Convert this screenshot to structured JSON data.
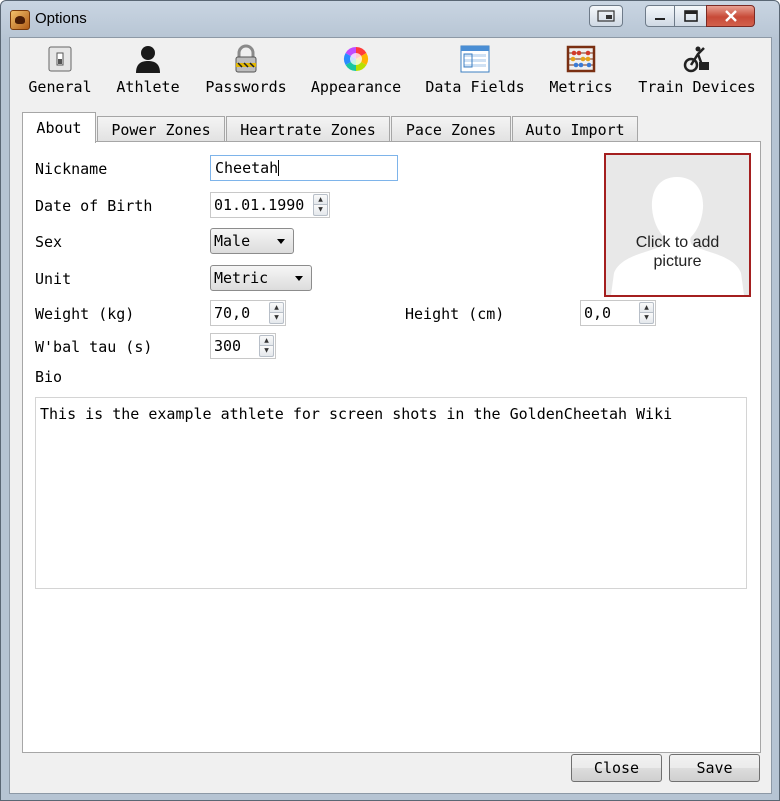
{
  "window": {
    "title": "Options"
  },
  "toolbar": {
    "items": [
      {
        "label": "General",
        "icon": "general-icon"
      },
      {
        "label": "Athlete",
        "icon": "athlete-icon"
      },
      {
        "label": "Passwords",
        "icon": "lock-icon"
      },
      {
        "label": "Appearance",
        "icon": "color-wheel-icon"
      },
      {
        "label": "Data Fields",
        "icon": "data-fields-icon"
      },
      {
        "label": "Metrics",
        "icon": "abacus-icon"
      },
      {
        "label": "Train Devices",
        "icon": "trainer-icon"
      }
    ]
  },
  "tabs": [
    {
      "label": "About",
      "active": true
    },
    {
      "label": "Power Zones"
    },
    {
      "label": "Heartrate Zones"
    },
    {
      "label": "Pace Zones"
    },
    {
      "label": "Auto Import"
    }
  ],
  "about": {
    "nickname_label": "Nickname",
    "nickname_value": "Cheetah",
    "dob_label": "Date of Birth",
    "dob_value": "01.01.1990",
    "sex_label": "Sex",
    "sex_value": "Male",
    "unit_label": "Unit",
    "unit_value": "Metric",
    "weight_label": "Weight (kg)",
    "weight_value": "70,0",
    "height_label": "Height (cm)",
    "height_value": "0,0",
    "wbal_label": "W'bal tau (s)",
    "wbal_value": "300",
    "bio_label": "Bio",
    "bio_value": "This is the example athlete for screen shots in the GoldenCheetah Wiki",
    "picture_caption_line1": "Click to add",
    "picture_caption_line2": "picture"
  },
  "buttons": {
    "close": "Close",
    "save": "Save"
  },
  "colors": {
    "picture_border": "#a41f1f",
    "focus_border": "#7eb4ea",
    "close_button": "#c74a38"
  }
}
